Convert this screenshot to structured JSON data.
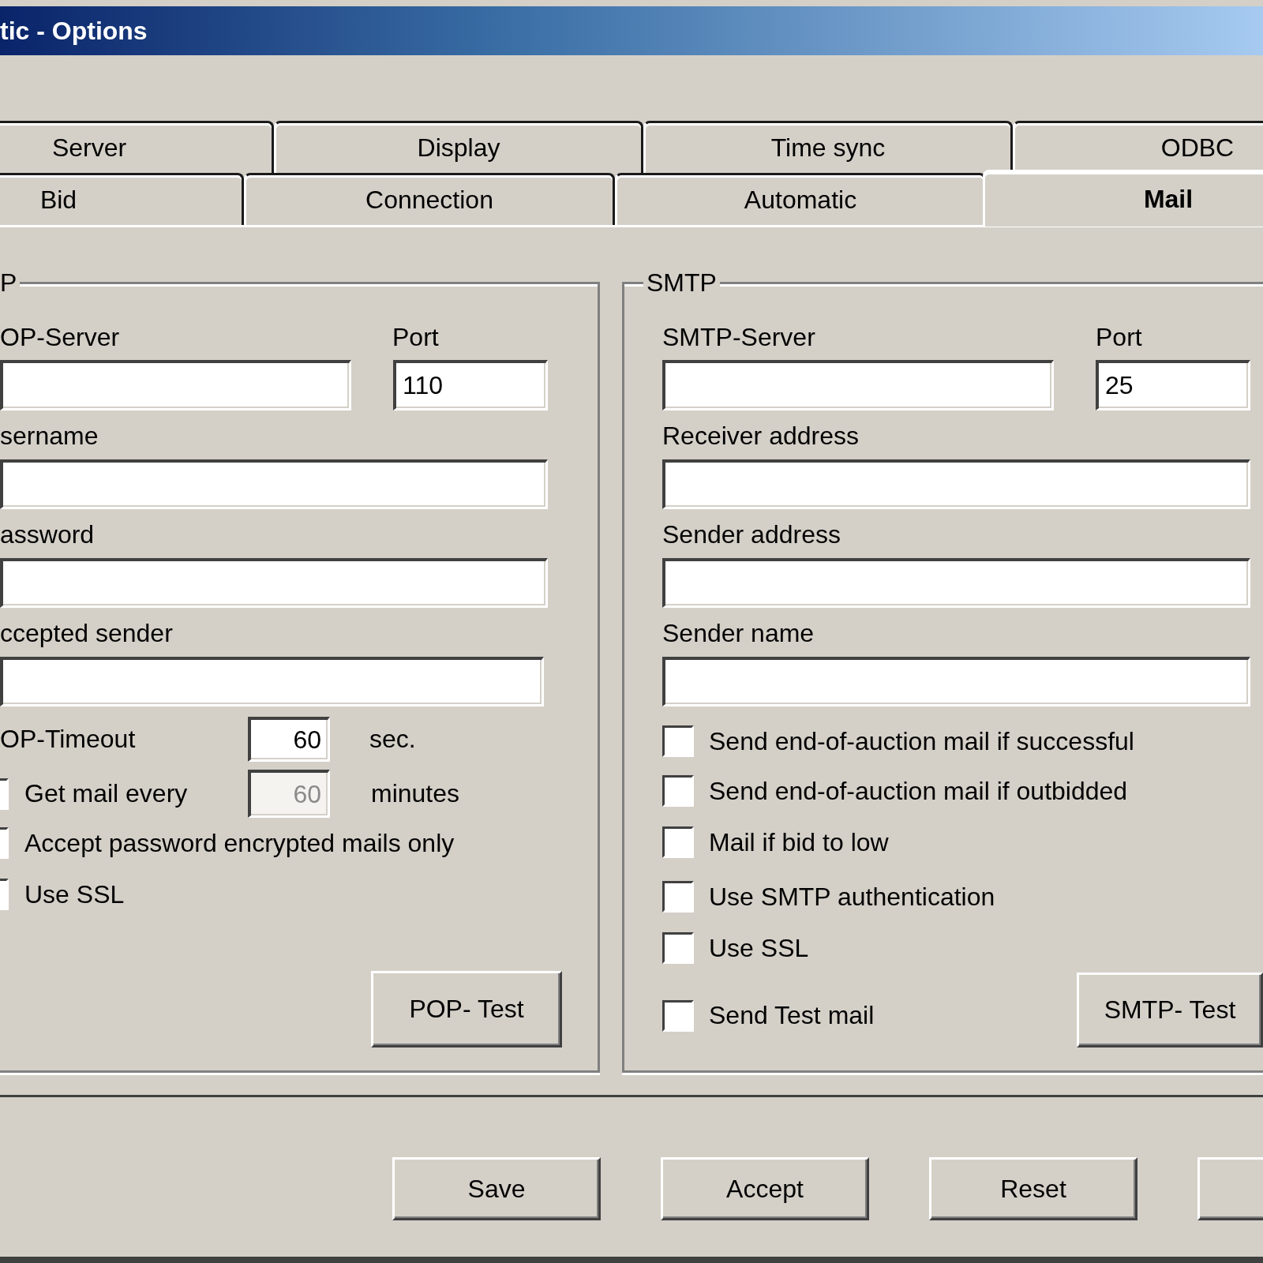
{
  "window": {
    "title": "tic - Options"
  },
  "tab_rows": [
    [
      {
        "label": "Server",
        "selected": false
      },
      {
        "label": "Display",
        "selected": false
      },
      {
        "label": "Time sync",
        "selected": false
      },
      {
        "label": "ODBC",
        "selected": false
      }
    ],
    [
      {
        "label": "Bid",
        "selected": false
      },
      {
        "label": "Connection",
        "selected": false
      },
      {
        "label": "Automatic",
        "selected": false
      },
      {
        "label": "Mail",
        "selected": true
      }
    ]
  ],
  "pop": {
    "legend": "P",
    "server": {
      "label": "OP-Server"
    },
    "port": {
      "label": "Port",
      "value": "110"
    },
    "fields": [
      {
        "label": "sername"
      },
      {
        "label": "assword"
      },
      {
        "label": "ccepted sender"
      }
    ],
    "timeout": {
      "label": "OP-Timeout",
      "value": "60",
      "unit": "sec."
    },
    "interval": {
      "label": "Get mail every",
      "checked": false,
      "value": "60",
      "disabled": true,
      "unit": "minutes"
    },
    "options": [
      {
        "label": "Accept password encrypted mails only",
        "checked": false
      },
      {
        "label": "Use SSL",
        "checked": false
      }
    ],
    "test_button": "POP- Test"
  },
  "smtp": {
    "legend": "SMTP",
    "server": {
      "label": "SMTP-Server"
    },
    "port": {
      "label": "Port",
      "value": "25"
    },
    "fields": [
      {
        "label": "Receiver address"
      },
      {
        "label": "Sender address"
      },
      {
        "label": "Sender name"
      }
    ],
    "options": [
      {
        "label": "Send end-of-auction mail if successful",
        "checked": false
      },
      {
        "label": "Send end-of-auction mail if outbidded",
        "checked": false
      },
      {
        "label": "Mail if bid to low",
        "checked": false
      },
      {
        "label": "Use SMTP authentication",
        "checked": false
      },
      {
        "label": "Use SSL",
        "checked": false
      },
      {
        "label": "Send Test mail",
        "checked": false
      }
    ],
    "test_button": "SMTP- Test"
  },
  "buttons": [
    {
      "kind": "text",
      "label": "Save"
    },
    {
      "kind": "text",
      "label": "Accept"
    },
    {
      "kind": "text",
      "label": "Reset"
    },
    {
      "kind": "cut"
    }
  ]
}
